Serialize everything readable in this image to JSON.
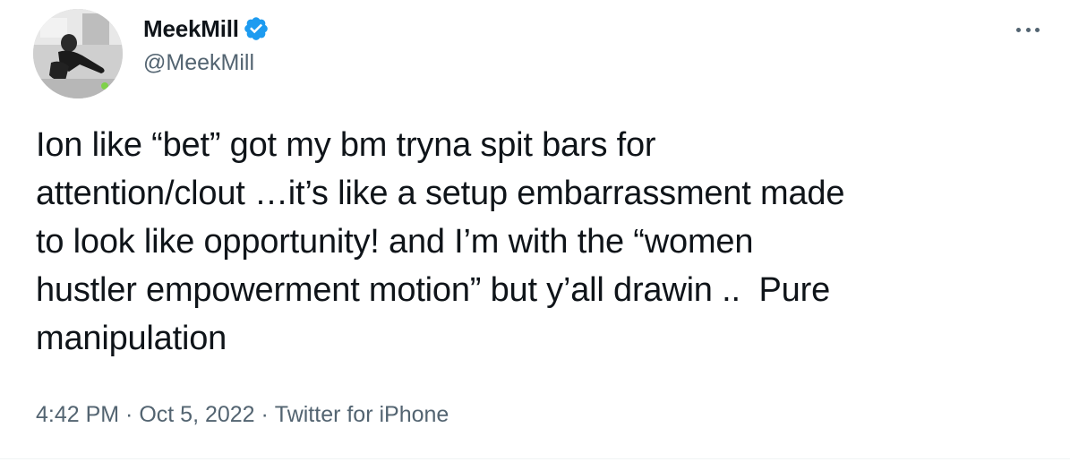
{
  "author": {
    "display_name": "MeekMill",
    "handle": "@MeekMill",
    "verified": true,
    "verified_color": "#1d9bf0"
  },
  "tweet": {
    "text": "Ion like “bet” got my bm tryna spit bars for\nattention/clout …it’s like a setup embarrassment made\nto look like opportunity! and I’m with the “women\nhustler empowerment motion” but y’all drawin ..  Pure\nmanipulation",
    "time": "4:42 PM",
    "date": "Oct 5, 2022",
    "source": "Twitter for iPhone",
    "separator": " · "
  },
  "icons": {
    "verified": "verified-badge-icon",
    "more": "more-options-icon"
  },
  "colors": {
    "text_primary": "#0f1419",
    "text_secondary": "#536471",
    "accent": "#1d9bf0"
  }
}
